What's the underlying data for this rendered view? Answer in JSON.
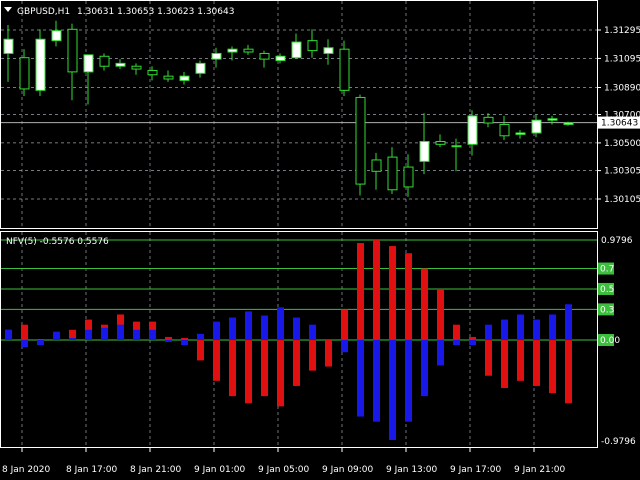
{
  "header": {
    "symbol_timeframe": "GBPUSD,H1",
    "ohlc": "1.30631 1.30653 1.30623 1.30643"
  },
  "indicator": {
    "label": "NFV(5) -0.5576 0.5576",
    "levels": [
      "0.7",
      "0.5",
      "0.3",
      "0.00"
    ],
    "level_values": [
      0.7,
      0.5,
      0.3,
      0.0
    ],
    "top_label": "0.9796",
    "bottom_label": "-0.9796"
  },
  "colors": {
    "background": "#000000",
    "grid": "#9aa3ad",
    "bull": "#ffffff",
    "bear": "#ffffff",
    "wick": "#33dd33",
    "level_line": "#3cbf3c",
    "level_badge": "#3cbf3c",
    "histo_pos": "#e01010",
    "histo_neg": "#1818e8",
    "bid_line": "#b0b0b0"
  },
  "price_axis": {
    "labels": [
      "1.31295",
      "1.31095",
      "1.30890",
      "1.30700",
      "1.30500",
      "1.30305",
      "1.30105"
    ],
    "values": [
      1.31295,
      1.31095,
      1.3089,
      1.307,
      1.305,
      1.30305,
      1.30105
    ],
    "current": "1.30643",
    "current_value": 1.30643
  },
  "time_axis": [
    "8 Jan 2020",
    "8 Jan 17:00",
    "8 Jan 21:00",
    "9 Jan 01:00",
    "9 Jan 05:00",
    "9 Jan 09:00",
    "9 Jan 13:00",
    "9 Jan 17:00",
    "9 Jan 21:00"
  ],
  "chart_data": {
    "type": "candlestick",
    "candles": [
      {
        "o": 1.3113,
        "h": 1.3133,
        "l": 1.3093,
        "c": 1.3123
      },
      {
        "o": 1.311,
        "h": 1.3116,
        "l": 1.3083,
        "c": 1.3088
      },
      {
        "o": 1.3087,
        "h": 1.313,
        "l": 1.3083,
        "c": 1.3123
      },
      {
        "o": 1.3122,
        "h": 1.3136,
        "l": 1.3118,
        "c": 1.3129
      },
      {
        "o": 1.313,
        "h": 1.3134,
        "l": 1.308,
        "c": 1.31
      },
      {
        "o": 1.31,
        "h": 1.3112,
        "l": 1.3077,
        "c": 1.3112
      },
      {
        "o": 1.3111,
        "h": 1.3113,
        "l": 1.3101,
        "c": 1.3104
      },
      {
        "o": 1.3104,
        "h": 1.3109,
        "l": 1.3102,
        "c": 1.3106
      },
      {
        "o": 1.3104,
        "h": 1.3106,
        "l": 1.3098,
        "c": 1.3102
      },
      {
        "o": 1.3101,
        "h": 1.3104,
        "l": 1.3094,
        "c": 1.3098
      },
      {
        "o": 1.3097,
        "h": 1.3101,
        "l": 1.3093,
        "c": 1.3095
      },
      {
        "o": 1.3094,
        "h": 1.31,
        "l": 1.3091,
        "c": 1.3097
      },
      {
        "o": 1.3099,
        "h": 1.3108,
        "l": 1.3096,
        "c": 1.3106
      },
      {
        "o": 1.3109,
        "h": 1.3117,
        "l": 1.3103,
        "c": 1.3113
      },
      {
        "o": 1.3114,
        "h": 1.3118,
        "l": 1.3108,
        "c": 1.3116
      },
      {
        "o": 1.3116,
        "h": 1.3119,
        "l": 1.3112,
        "c": 1.3114
      },
      {
        "o": 1.3113,
        "h": 1.3115,
        "l": 1.3103,
        "c": 1.3109
      },
      {
        "o": 1.3108,
        "h": 1.3113,
        "l": 1.3106,
        "c": 1.3111
      },
      {
        "o": 1.311,
        "h": 1.3127,
        "l": 1.3109,
        "c": 1.3121
      },
      {
        "o": 1.3122,
        "h": 1.313,
        "l": 1.311,
        "c": 1.3115
      },
      {
        "o": 1.3113,
        "h": 1.3123,
        "l": 1.3105,
        "c": 1.3117
      },
      {
        "o": 1.3116,
        "h": 1.3122,
        "l": 1.3083,
        "c": 1.3087
      },
      {
        "o": 1.3082,
        "h": 1.3084,
        "l": 1.3013,
        "c": 1.3021
      },
      {
        "o": 1.3038,
        "h": 1.3043,
        "l": 1.3017,
        "c": 1.303
      },
      {
        "o": 1.304,
        "h": 1.3047,
        "l": 1.3014,
        "c": 1.3017
      },
      {
        "o": 1.3033,
        "h": 1.3042,
        "l": 1.3012,
        "c": 1.3019
      },
      {
        "o": 1.3037,
        "h": 1.3071,
        "l": 1.3028,
        "c": 1.3051
      },
      {
        "o": 1.3051,
        "h": 1.3056,
        "l": 1.3047,
        "c": 1.3049
      },
      {
        "o": 1.3048,
        "h": 1.3053,
        "l": 1.303,
        "c": 1.3048
      },
      {
        "o": 1.3049,
        "h": 1.3073,
        "l": 1.3041,
        "c": 1.3069
      },
      {
        "o": 1.3068,
        "h": 1.3071,
        "l": 1.3061,
        "c": 1.3064
      },
      {
        "o": 1.3063,
        "h": 1.3069,
        "l": 1.3052,
        "c": 1.3055
      },
      {
        "o": 1.3056,
        "h": 1.3059,
        "l": 1.3053,
        "c": 1.3057
      },
      {
        "o": 1.3057,
        "h": 1.307,
        "l": 1.3054,
        "c": 1.3066
      },
      {
        "o": 1.3066,
        "h": 1.3069,
        "l": 1.3063,
        "c": 1.3067
      },
      {
        "o": 1.3063,
        "h": 1.3065,
        "l": 1.3062,
        "c": 1.3064
      }
    ],
    "histogram_pos": [
      0.1,
      0.15,
      0.01,
      0.08,
      0.1,
      0.2,
      0.15,
      0.25,
      0.18,
      0.18,
      0.03,
      0.02,
      0.2,
      0.4,
      0.55,
      0.62,
      0.55,
      0.65,
      0.45,
      0.3,
      0.26,
      0.3,
      0.95,
      0.98,
      0.92,
      0.85,
      0.7,
      0.5,
      0.15,
      0.03,
      0.35,
      0.47,
      0.4,
      0.45,
      0.52,
      0.62
    ],
    "histogram_neg": [
      0.08,
      0.07,
      0.05,
      0.12,
      0.06,
      0.1,
      0.15,
      0.13,
      0.08,
      0.05,
      0.02,
      0.05,
      0.22,
      0.45,
      0.6,
      0.52,
      0.55,
      0.48,
      0.38,
      0.35,
      0.45,
      0.12,
      0.75,
      0.8,
      0.98,
      0.8,
      0.55,
      0.25,
      0.05,
      0.05,
      0.12,
      0.3,
      0.38,
      0.28,
      0.3,
      0.25
    ],
    "histogram_neg_up": [
      0.1,
      0.0,
      0.0,
      0.08,
      0.02,
      0.1,
      0.12,
      0.15,
      0.1,
      0.1,
      0.0,
      0.0,
      0.06,
      0.18,
      0.22,
      0.28,
      0.24,
      0.32,
      0.22,
      0.15,
      0.0,
      0.02,
      0.0,
      0.0,
      0.0,
      0.0,
      0.0,
      0.0,
      0.1,
      0.02,
      0.15,
      0.2,
      0.25,
      0.2,
      0.25,
      0.35
    ]
  }
}
